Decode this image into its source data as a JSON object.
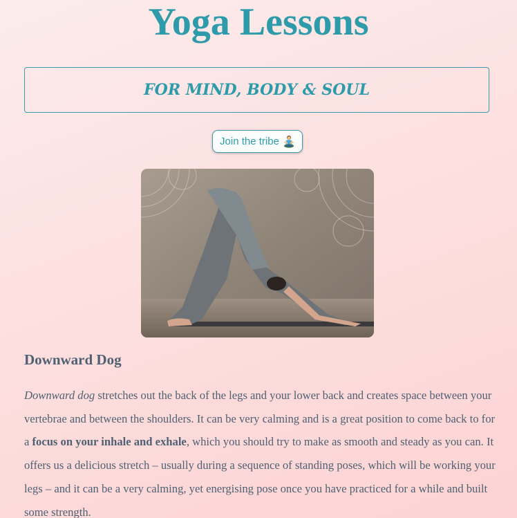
{
  "header": {
    "title": "Yoga Lessons",
    "tagline": "FOR MIND, BODY & SOUL"
  },
  "cta": {
    "label": "Join the tribe",
    "icon": "meditating-person-icon"
  },
  "hero_image": {
    "alt": "Downward dog pose"
  },
  "pose": {
    "heading": "Downward Dog",
    "description": {
      "lead_italic": "Downward dog",
      "part1": " stretches out the back of the legs and your lower back and creates space between your vertebrae and between the shoulders. It can be very calming and is a great position to come back to for a ",
      "emphasis": "focus on your inhale and exhale",
      "part2": ", which you should try to make as smooth and steady as you can. It offers us a delicious stretch – usually during a sequence of standing poses, which will be working your legs – and it can be a very calming, yet energising pose once you have practiced for a while and built some strength."
    }
  },
  "colors": {
    "accent": "#2e9bab",
    "text": "#4e6173",
    "background_start": "#fbeceb",
    "background_end": "#fdd3d3"
  }
}
